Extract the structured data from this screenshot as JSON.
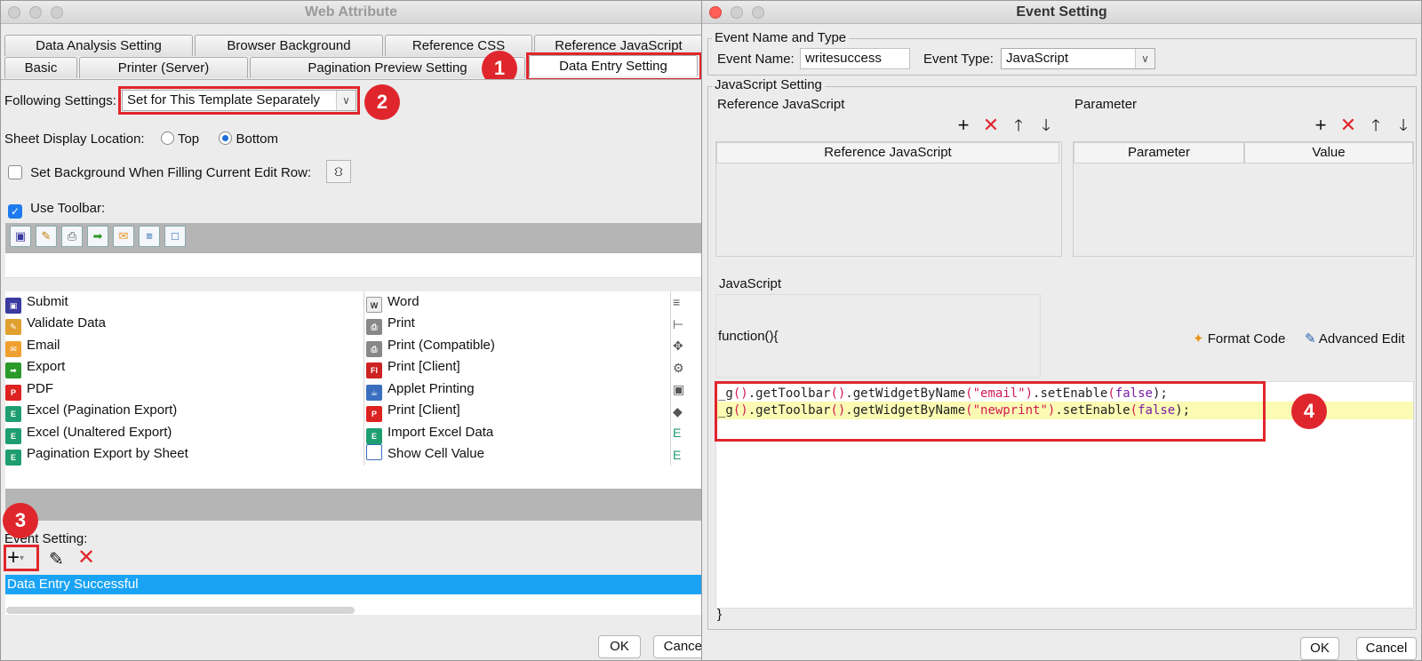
{
  "web_attribute": {
    "title": "Web Attribute",
    "tabs_row1": [
      "Data Analysis Setting",
      "Browser Background",
      "Reference CSS",
      "Reference JavaScript"
    ],
    "tabs_row2": [
      "Basic",
      "Printer (Server)",
      "Pagination Preview Setting",
      "Data Entry Setting"
    ],
    "following_label": "Following Settings:",
    "following_value": "Set for This Template Separately",
    "sheet_display_label": "Sheet Display Location:",
    "sheet_top": "Top",
    "sheet_bottom": "Bottom",
    "set_background_label": "Set Background When Filling Current Edit Row:",
    "use_toolbar_label": "Use Toolbar:",
    "col1": [
      "Submit",
      "Validate Data",
      "Email",
      "Export",
      "PDF",
      "Excel (Pagination Export)",
      "Excel (Unaltered Export)",
      "Pagination Export by Sheet"
    ],
    "col2": [
      "Word",
      "Print",
      "Print (Compatible)",
      "Print [Client]",
      "Applet Printing",
      "Print [Client]",
      "Import Excel Data",
      "Show Cell Value"
    ],
    "event_setting_label": "Event Setting:",
    "event_item": "Data Entry Successful",
    "ok": "OK",
    "cancel": "Cancel"
  },
  "event_setting": {
    "title": "Event Setting",
    "name_type_legend": "Event Name and Type",
    "event_name_label": "Event Name:",
    "event_name_value": "writesuccess",
    "event_type_label": "Event Type:",
    "event_type_value": "JavaScript",
    "js_setting_legend": "JavaScript Setting",
    "ref_js_title": "Reference JavaScript",
    "ref_js_header": "Reference JavaScript",
    "param_title": "Parameter",
    "param_header": "Parameter",
    "value_header": "Value",
    "javascript_title": "JavaScript",
    "function_open": "function(){",
    "format_code": "Format Code",
    "advanced_edit": "Advanced Edit",
    "code_line1": {
      "a": "_g",
      "b": "()",
      "c": ".getToolbar",
      "d": "()",
      "e": ".getWidgetByName",
      "f": "(",
      "g": "\"email\"",
      "h": ")",
      "i": ".setEnable",
      "j": "(",
      "k": "false",
      "l": ");"
    },
    "code_line2": {
      "a": "_g",
      "b": "()",
      "c": ".getToolbar",
      "d": "()",
      "e": ".getWidgetByName",
      "f": "(",
      "g": "\"newprint\"",
      "h": ")",
      "i": ".setEnable",
      "j": "(",
      "k": "false",
      "l": ");"
    },
    "function_close": "}",
    "ok": "OK",
    "cancel": "Cancel"
  },
  "badges": [
    "1",
    "2",
    "3",
    "4"
  ],
  "colors": {
    "accent_red": "#e0262d",
    "selection_blue": "#1aa3f5",
    "code_highlight": "#fbfbb4"
  }
}
